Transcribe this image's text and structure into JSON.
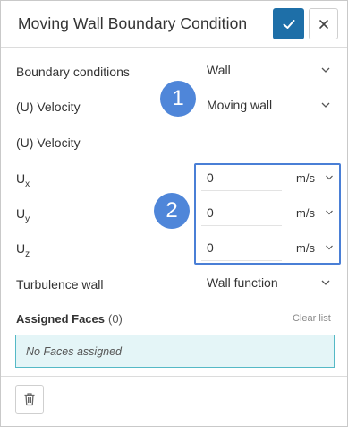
{
  "dialog": {
    "title": "Moving Wall Boundary Condition"
  },
  "header": {
    "confirm_icon": "check-icon",
    "close_icon": "close-icon"
  },
  "fields": {
    "boundary_conditions": {
      "label": "Boundary conditions",
      "value": "Wall"
    },
    "velocity_type": {
      "label": "(U) Velocity",
      "value": "Moving wall"
    },
    "velocity_heading": {
      "label": "(U) Velocity"
    },
    "ux": {
      "label_main": "U",
      "label_sub": "x",
      "value": "0",
      "unit": "m/s"
    },
    "uy": {
      "label_main": "U",
      "label_sub": "y",
      "value": "0",
      "unit": "m/s"
    },
    "uz": {
      "label_main": "U",
      "label_sub": "z",
      "value": "0",
      "unit": "m/s"
    },
    "turbulence_wall": {
      "label": "Turbulence wall",
      "value": "Wall function"
    }
  },
  "annotations": {
    "badge_1": "1",
    "badge_2": "2"
  },
  "assigned_faces": {
    "title": "Assigned Faces",
    "count": "(0)",
    "clear_label": "Clear list",
    "empty_text": "No Faces assigned"
  },
  "footer": {
    "delete_icon": "trash-icon"
  },
  "colors": {
    "primary": "#1e6fa8",
    "annotation": "#4f86d9",
    "faces_bg": "#e4f5f7",
    "faces_border": "#55b9c6"
  }
}
